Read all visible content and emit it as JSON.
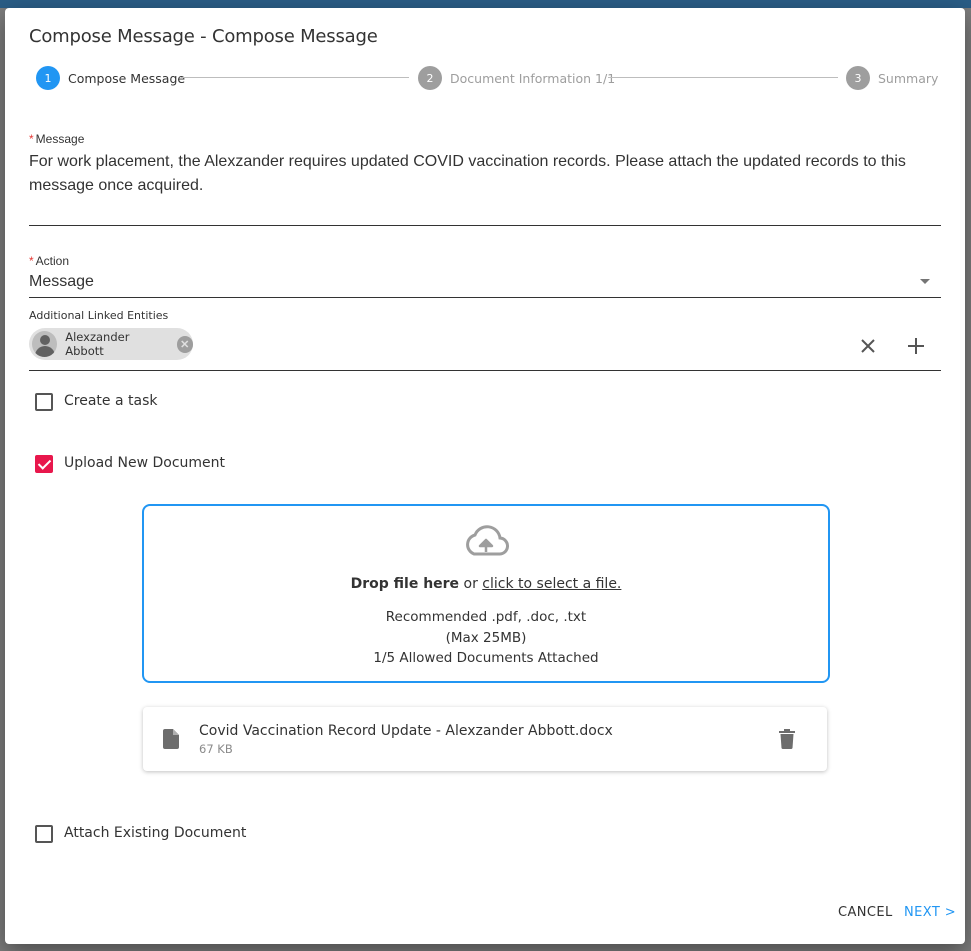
{
  "dialog": {
    "title": "Compose Message - Compose Message"
  },
  "stepper": {
    "steps": [
      {
        "number": "1",
        "label": "Compose Message",
        "state": "active"
      },
      {
        "number": "2",
        "label": "Document Information 1/1",
        "state": "inactive"
      },
      {
        "number": "3",
        "label": "Summary",
        "state": "inactive"
      }
    ]
  },
  "message": {
    "label": "Message",
    "required_mark": "*",
    "value": "For work placement, the Alexzander requires updated COVID vaccination records. Please attach the updated records to this message once acquired."
  },
  "action": {
    "label": "Action",
    "required_mark": "*",
    "value": "Message"
  },
  "linked_entities": {
    "label": "Additional Linked Entities",
    "chips": [
      {
        "label": "Alexzander Abbott"
      }
    ]
  },
  "create_task": {
    "label": "Create a task",
    "checked": false
  },
  "upload_new": {
    "label": "Upload New Document",
    "checked": true
  },
  "dropzone": {
    "bold_text": "Drop file here",
    "or_text": " or ",
    "link_text": "click to select a file.",
    "recommended": "Recommended .pdf, .doc, .txt",
    "max_size": "(Max 25MB)",
    "count": "1/5 Allowed Documents Attached"
  },
  "files": [
    {
      "name": "Covid Vaccination Record Update - Alexzander Abbott.docx",
      "size": "67 KB"
    }
  ],
  "attach_existing": {
    "label": "Attach Existing Document",
    "checked": false
  },
  "footer": {
    "cancel_label": "CANCEL",
    "next_label": "NEXT >"
  },
  "colors": {
    "primary": "#2196f3",
    "accent_checkbox": "#e8174c",
    "inactive": "#9e9e9e"
  }
}
